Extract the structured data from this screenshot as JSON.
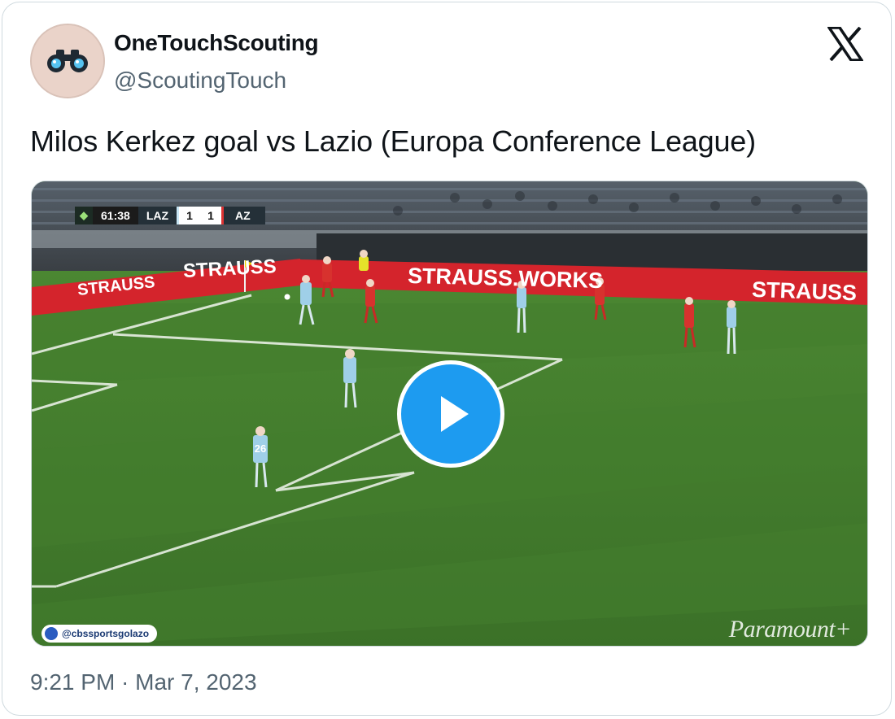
{
  "author": {
    "display_name": "OneTouchScouting",
    "handle": "@ScoutingTouch",
    "avatar_icon": "binoculars-icon"
  },
  "platform_icon": "x-logo-icon",
  "tweet": {
    "text": "Milos Kerkez goal vs Lazio (Europa Conference League)",
    "timestamp": "9:21 PM · Mar 7, 2023"
  },
  "video": {
    "scorebug": {
      "clock": "61:38",
      "home_team": "LAZ",
      "home_score": "1",
      "away_score": "1",
      "away_team": "AZ"
    },
    "ad_boards": [
      "STRAUSS",
      "STRAUSS",
      "STRAUSS.WORKS",
      "STRAUSS"
    ],
    "jersey_number": "26",
    "credit_handle": "@cbssportsgolazo",
    "broadcaster": "Paramount+",
    "play_icon": "play-icon"
  },
  "colors": {
    "accent": "#1d9bf0",
    "text_primary": "#0f1419",
    "text_secondary": "#536471",
    "border": "#cfd9de",
    "ad_board_red": "#d4242c",
    "pitch_green": "#3f7a2c"
  }
}
